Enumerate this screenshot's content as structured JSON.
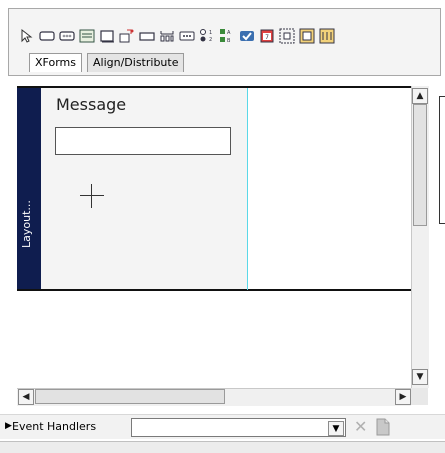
{
  "palette": {
    "icons": [
      "pointer-icon",
      "input-icon",
      "secret-icon",
      "textarea-icon",
      "output-icon",
      "range-icon",
      "trigger-icon",
      "submit-icon",
      "upload-icon",
      "select1-icon",
      "select-icon",
      "checkbox-icon",
      "date-icon",
      "group-icon",
      "switch-icon",
      "repeat-icon"
    ],
    "tabs": [
      {
        "label": "XForms",
        "active": true
      },
      {
        "label": "Align/Distribute",
        "active": false
      }
    ]
  },
  "canvas": {
    "layout_label": "Layout...",
    "message_label": "Message",
    "message_value": "",
    "guide_color": "#5ad8e8",
    "strip_color": "#0f1d4f"
  },
  "scrollbars": {
    "up": "▲",
    "down": "▼",
    "left": "◀",
    "right": "▶"
  },
  "event_handlers": {
    "toggle": "▶",
    "label": "Event Handlers",
    "selected_value": "",
    "dropdown_glyph": "▼",
    "delete_glyph": "✕"
  }
}
